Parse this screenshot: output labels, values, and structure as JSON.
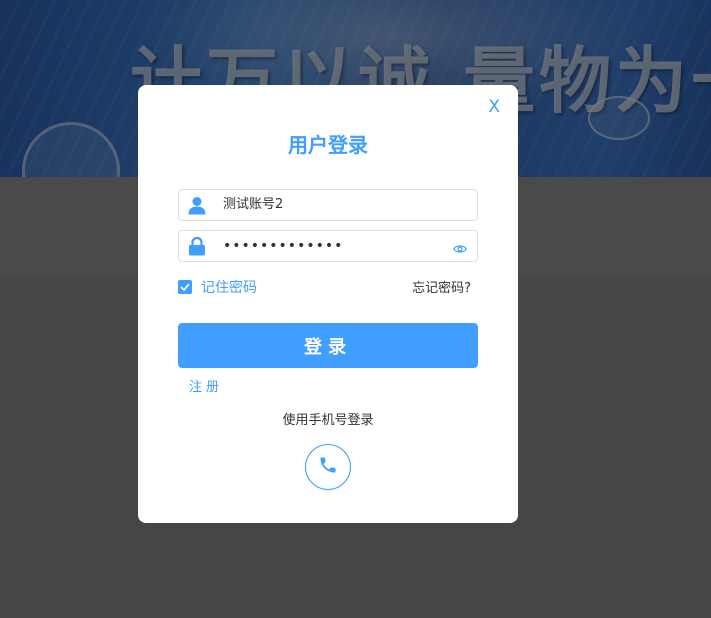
{
  "banner": {
    "slogan": "计万以诚  量物为一"
  },
  "modal": {
    "close_label": "X",
    "title": "用户登录",
    "username": {
      "value": "测试账号2",
      "icon": "user-icon"
    },
    "password": {
      "value": "•••••••••••••",
      "icon": "lock-icon",
      "toggle_icon": "eye-icon"
    },
    "remember": {
      "label": "记住密码",
      "checked": true
    },
    "forgot_label": "忘记密码?",
    "login_label": "登录",
    "register_label": "注册",
    "phone_login_label": "使用手机号登录",
    "phone_icon": "phone-icon"
  },
  "colors": {
    "accent": "#409eff",
    "text": "#303133",
    "overlay": "rgba(0,0,0,0.45)"
  }
}
